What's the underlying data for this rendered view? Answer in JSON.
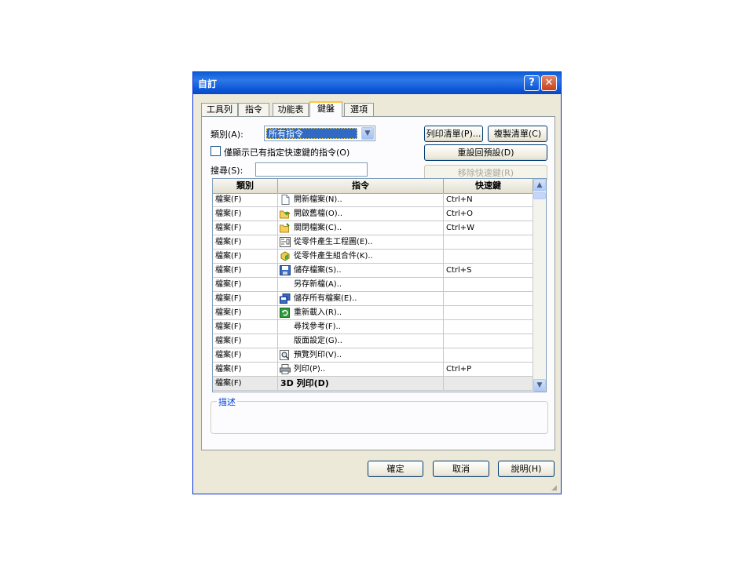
{
  "dialog": {
    "title": "自訂",
    "help_label": "?",
    "close_label": "✕"
  },
  "tabs": [
    {
      "label": "工具列"
    },
    {
      "label": "指令"
    },
    {
      "label": "功能表"
    },
    {
      "label": "鍵盤",
      "active": true
    },
    {
      "label": "選項"
    }
  ],
  "category": {
    "label": "類別(A):",
    "value": "所有指令",
    "arrow": "▼"
  },
  "only_assigned": {
    "label": "僅顯示已有指定快速鍵的指令(O)",
    "checked": false
  },
  "search": {
    "label": "搜尋(S):",
    "value": ""
  },
  "buttons": {
    "print_list": "列印清單(P)...",
    "copy_list": "複製清單(C)",
    "reset_defaults": "重設回預設(D)",
    "remove_shortcut": "移除快速鍵(R)",
    "ok": "確定",
    "cancel": "取消",
    "help": "說明(H)"
  },
  "grid": {
    "headers": [
      "類別",
      "指令",
      "快速鍵"
    ],
    "rows": [
      {
        "category": "檔案(F)",
        "command": "開新檔案(N)..",
        "shortcut": "Ctrl+N",
        "icon": "new-document-icon"
      },
      {
        "category": "檔案(F)",
        "command": "開啟舊檔(O)..",
        "shortcut": "Ctrl+O",
        "icon": "open-folder-icon"
      },
      {
        "category": "檔案(F)",
        "command": "關閉檔案(C)..",
        "shortcut": "Ctrl+W",
        "icon": "close-folder-icon"
      },
      {
        "category": "檔案(F)",
        "command": "從零件產生工程圖(E)..",
        "shortcut": "",
        "icon": "drawing-icon"
      },
      {
        "category": "檔案(F)",
        "command": "從零件產生組合件(K)..",
        "shortcut": "",
        "icon": "assembly-icon"
      },
      {
        "category": "檔案(F)",
        "command": "儲存檔案(S)..",
        "shortcut": "Ctrl+S",
        "icon": "save-icon"
      },
      {
        "category": "檔案(F)",
        "command": "另存新檔(A)..",
        "shortcut": "",
        "icon": ""
      },
      {
        "category": "檔案(F)",
        "command": "儲存所有檔案(E)..",
        "shortcut": "",
        "icon": "save-all-icon"
      },
      {
        "category": "檔案(F)",
        "command": "重新載入(R)..",
        "shortcut": "",
        "icon": "reload-icon"
      },
      {
        "category": "檔案(F)",
        "command": "尋找參考(F)..",
        "shortcut": "",
        "icon": ""
      },
      {
        "category": "檔案(F)",
        "command": "版面設定(G)..",
        "shortcut": "",
        "icon": ""
      },
      {
        "category": "檔案(F)",
        "command": "預覽列印(V)..",
        "shortcut": "",
        "icon": "print-preview-icon"
      },
      {
        "category": "檔案(F)",
        "command": "列印(P)..",
        "shortcut": "Ctrl+P",
        "icon": "printer-icon"
      },
      {
        "category": "檔案(F)",
        "command": "3D 列印(D)",
        "shortcut": "",
        "icon": "",
        "bold": true
      }
    ],
    "scroll_up": "▲",
    "scroll_down": "▼"
  },
  "description": {
    "label": "描述"
  },
  "colors": {
    "selection": "#316ac5",
    "titlebar": "#0a5fd8",
    "tab_highlight": "#ffc83c"
  }
}
